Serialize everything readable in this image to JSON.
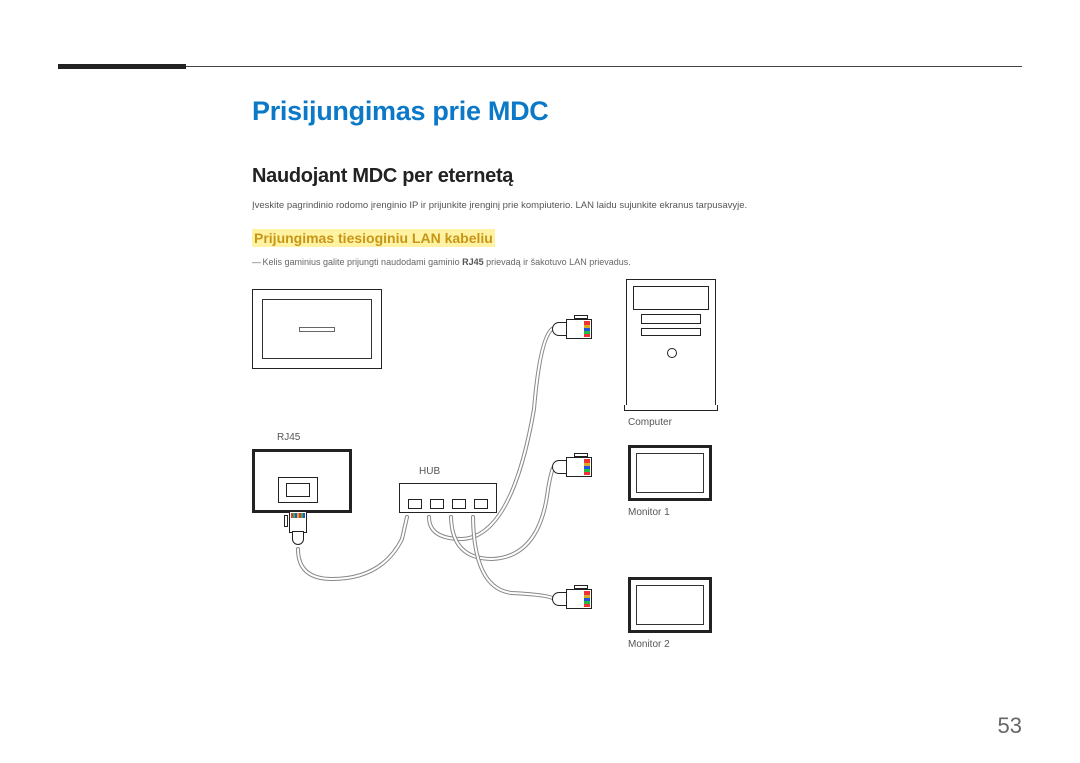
{
  "title": "Prisijungimas prie MDC",
  "section": "Naudojant MDC per eternetą",
  "intro": "Įveskite pagrindinio rodomo įrenginio IP ir prijunkite įrenginį prie kompiuterio. LAN laidu sujunkite ekranus tarpusavyje.",
  "subsection": "Prijungimas tiesioginiu LAN kabeliu",
  "note_prefix": "―",
  "note_text_before": " Kelis gaminius galite prijungti naudodami gaminio ",
  "note_bold": "RJ45",
  "note_text_after": " prievadą ir šakotuvo LAN prievadus.",
  "labels": {
    "rj45": "RJ45",
    "hub": "HUB",
    "computer": "Computer",
    "monitor1": "Monitor 1",
    "monitor2": "Monitor 2"
  },
  "page_number": "53"
}
